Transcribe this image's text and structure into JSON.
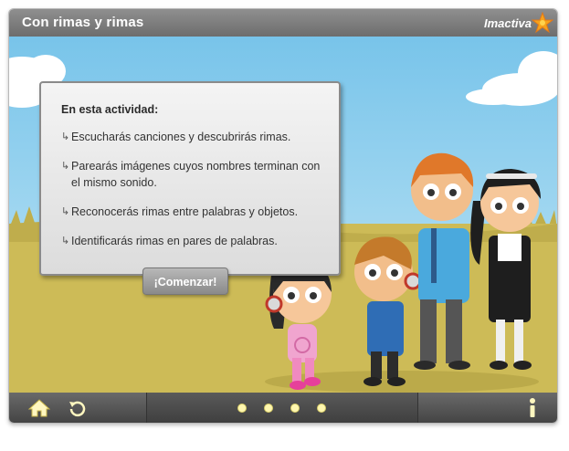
{
  "window": {
    "title": "Con rimas y rimas",
    "brand": "Imactiva"
  },
  "panel": {
    "heading": "En esta actividad:",
    "items": [
      "Escucharás canciones y descubrirás rimas.",
      "Parearás imágenes cuyos nombres terminan con el mismo sonido.",
      "Reconocerás rimas entre palabras y objetos.",
      "Identificarás rimas en pares de palabras."
    ],
    "start_label": "¡Comenzar!"
  },
  "bottombar": {
    "icons": [
      "home-icon",
      "replay-icon",
      "info-icon"
    ],
    "page_dots": 4
  },
  "colors": {
    "sky": "#8fd0ee",
    "grass": "#cdbb57",
    "bar": "#5a5a5a",
    "dot": "#fff7b0",
    "brand_star": "#f7a21b"
  }
}
